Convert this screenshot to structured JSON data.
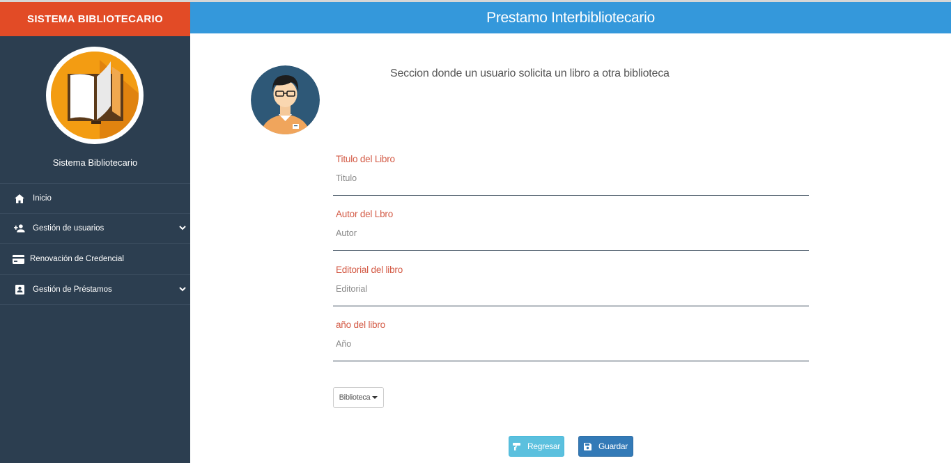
{
  "sidebar": {
    "brand": "SISTEMA BIBLIOTECARIO",
    "profile_name": "Sistema Bibliotecario",
    "logo_icon": "open-book-icon",
    "items": [
      {
        "label": "Inicio",
        "icon": "home-icon",
        "has_submenu": false
      },
      {
        "label": "Gestión de usuarios",
        "icon": "person-add-icon",
        "has_submenu": true
      },
      {
        "label": "Renovación de Credencial",
        "icon": "credit-card-icon",
        "has_submenu": false
      },
      {
        "label": "Gestión de Préstamos",
        "icon": "portrait-icon",
        "has_submenu": true
      }
    ]
  },
  "header": {
    "title": "Prestamo Interbibliotecario"
  },
  "main": {
    "description": "Seccion donde un usuario solicita un libro a otra biblioteca",
    "avatar_icon": "librarian-avatar",
    "fields": [
      {
        "label": "Titulo del Libro",
        "placeholder": "Titulo",
        "value": ""
      },
      {
        "label": "Autor del Lbro",
        "placeholder": "Autor",
        "value": ""
      },
      {
        "label": "Editorial del libro",
        "placeholder": "Editorial",
        "value": ""
      },
      {
        "label": "año del libro",
        "placeholder": "Año",
        "value": ""
      }
    ],
    "library_dropdown": "Biblioteca",
    "back_button": "Regresar",
    "save_button": "Guardar"
  },
  "colors": {
    "brand_bar": "#e24b26",
    "sidebar_bg": "#2c3e50",
    "header_bg": "#3498db",
    "label_color": "#d35a45",
    "back_button": "#5bc0de",
    "save_button": "#337ab7"
  }
}
